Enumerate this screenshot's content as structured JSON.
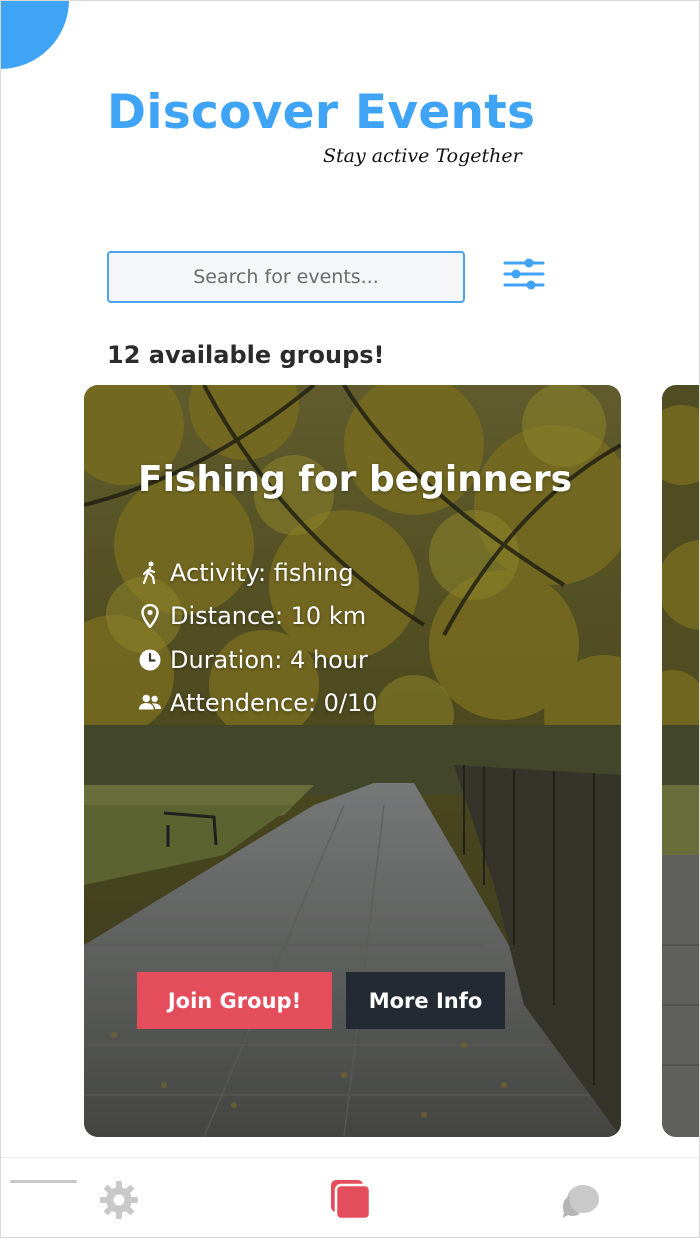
{
  "header": {
    "title": "Discover Events",
    "subtitle": "Stay active Together"
  },
  "search": {
    "placeholder": "Search for events...",
    "value": ""
  },
  "filter_icon": "sliders-icon",
  "groups_count_text": "12 available groups!",
  "event_card": {
    "title": "Fishing for beginners",
    "details": [
      {
        "icon": "walking-person-icon",
        "text": "Activity: fishing"
      },
      {
        "icon": "location-pin-icon",
        "text": "Distance: 10 km"
      },
      {
        "icon": "clock-icon",
        "text": "Duration: 4 hour"
      },
      {
        "icon": "people-icon",
        "text": "Attendence: 0/10"
      }
    ],
    "join_label": "Join Group!",
    "info_label": "More Info"
  },
  "bottom_nav": {
    "items": [
      {
        "icon": "gear-icon",
        "active": false
      },
      {
        "icon": "cards-icon",
        "active": true
      },
      {
        "icon": "chat-bubbles-icon",
        "active": false
      }
    ]
  },
  "colors": {
    "accent_blue": "#3fa3f6",
    "join_red": "#e44d5c",
    "info_dark": "#232a34",
    "nav_inactive": "#c9c9c9"
  }
}
